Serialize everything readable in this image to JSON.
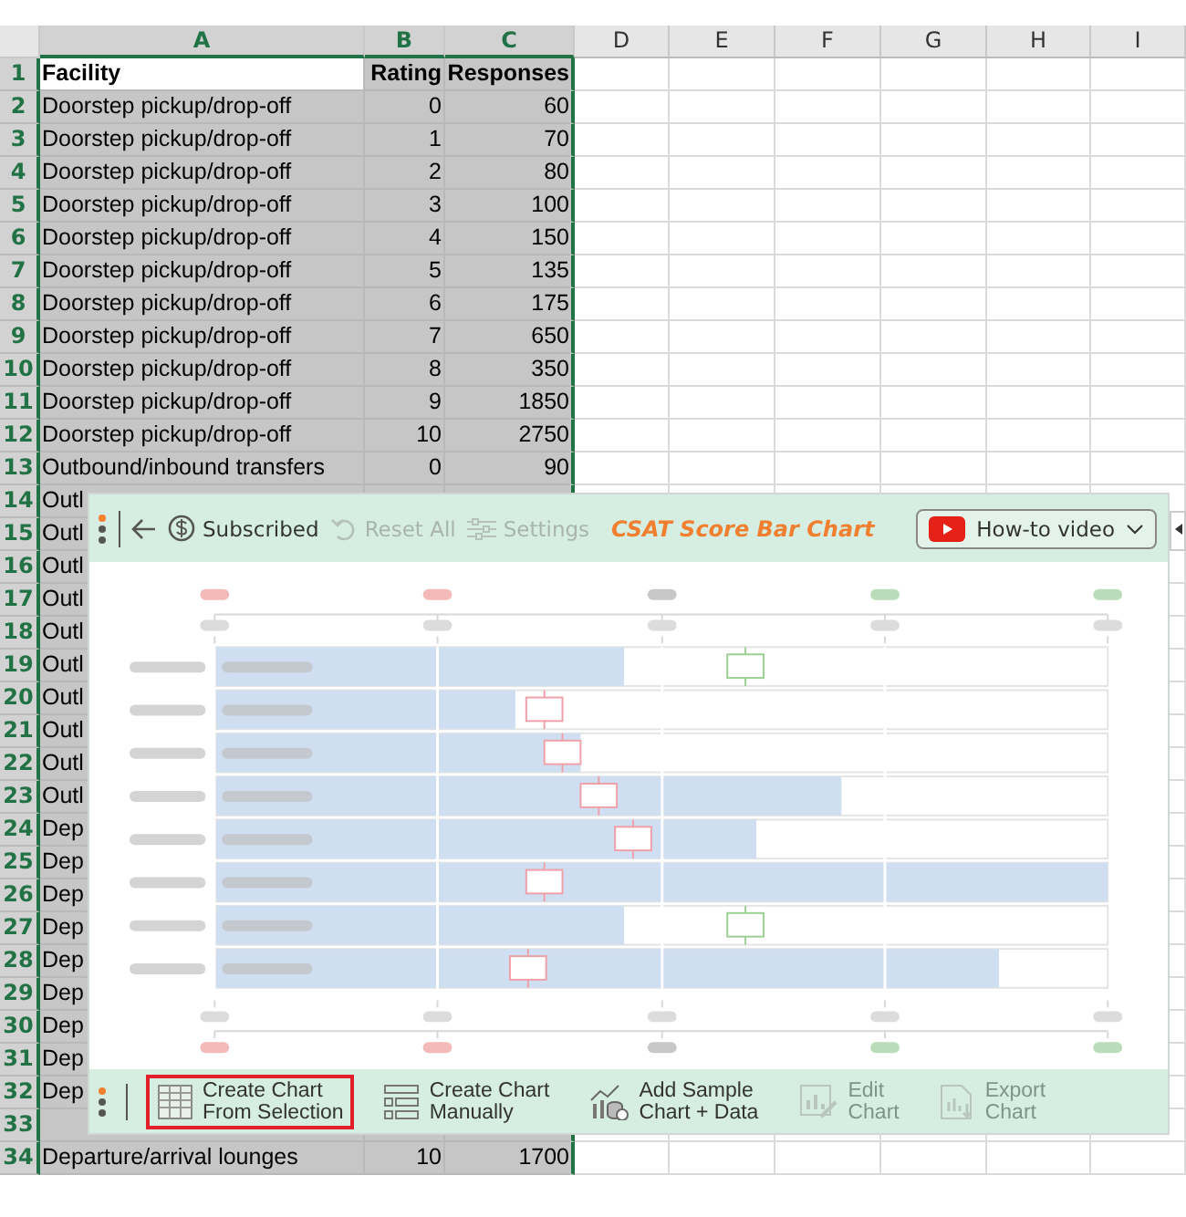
{
  "sheet": {
    "columns": [
      {
        "label": "A",
        "selected": true
      },
      {
        "label": "B",
        "selected": true
      },
      {
        "label": "C",
        "selected": true
      },
      {
        "label": "D",
        "selected": false
      },
      {
        "label": "E",
        "selected": false
      },
      {
        "label": "F",
        "selected": false
      },
      {
        "label": "G",
        "selected": false
      },
      {
        "label": "H",
        "selected": false
      },
      {
        "label": "I",
        "selected": false
      }
    ],
    "rows": [
      {
        "number": "1",
        "kind": "header",
        "cells": [
          "Facility",
          "Rating",
          "Responses"
        ]
      },
      {
        "number": "2",
        "cells": [
          "Doorstep pickup/drop-off",
          "0",
          "60"
        ]
      },
      {
        "number": "3",
        "cells": [
          "Doorstep pickup/drop-off",
          "1",
          "70"
        ]
      },
      {
        "number": "4",
        "cells": [
          "Doorstep pickup/drop-off",
          "2",
          "80"
        ]
      },
      {
        "number": "5",
        "cells": [
          "Doorstep pickup/drop-off",
          "3",
          "100"
        ]
      },
      {
        "number": "6",
        "cells": [
          "Doorstep pickup/drop-off",
          "4",
          "150"
        ]
      },
      {
        "number": "7",
        "cells": [
          "Doorstep pickup/drop-off",
          "5",
          "135"
        ]
      },
      {
        "number": "8",
        "cells": [
          "Doorstep pickup/drop-off",
          "6",
          "175"
        ]
      },
      {
        "number": "9",
        "cells": [
          "Doorstep pickup/drop-off",
          "7",
          "650"
        ]
      },
      {
        "number": "10",
        "cells": [
          "Doorstep pickup/drop-off",
          "8",
          "350"
        ]
      },
      {
        "number": "11",
        "cells": [
          "Doorstep pickup/drop-off",
          "9",
          "1850"
        ]
      },
      {
        "number": "12",
        "cells": [
          "Doorstep pickup/drop-off",
          "10",
          "2750"
        ]
      },
      {
        "number": "13",
        "cells": [
          "Outbound/inbound transfers",
          "0",
          "90"
        ]
      },
      {
        "number": "14",
        "cells": [
          "Outl"
        ]
      },
      {
        "number": "15",
        "cells": [
          "Outl"
        ]
      },
      {
        "number": "16",
        "cells": [
          "Outl"
        ]
      },
      {
        "number": "17",
        "cells": [
          "Outl"
        ]
      },
      {
        "number": "18",
        "cells": [
          "Outl"
        ]
      },
      {
        "number": "19",
        "cells": [
          "Outl"
        ]
      },
      {
        "number": "20",
        "cells": [
          "Outl"
        ]
      },
      {
        "number": "21",
        "cells": [
          "Outl"
        ]
      },
      {
        "number": "22",
        "cells": [
          "Outl"
        ]
      },
      {
        "number": "23",
        "cells": [
          "Outl"
        ]
      },
      {
        "number": "24",
        "cells": [
          "Dep"
        ]
      },
      {
        "number": "25",
        "cells": [
          "Dep"
        ]
      },
      {
        "number": "26",
        "cells": [
          "Dep"
        ]
      },
      {
        "number": "27",
        "cells": [
          "Dep"
        ]
      },
      {
        "number": "28",
        "cells": [
          "Dep"
        ]
      },
      {
        "number": "29",
        "cells": [
          "Dep"
        ]
      },
      {
        "number": "30",
        "cells": [
          "Dep"
        ]
      },
      {
        "number": "31",
        "cells": [
          "Dep"
        ]
      },
      {
        "number": "32",
        "cells": [
          "Dep"
        ]
      },
      {
        "number": "33",
        "cells": []
      },
      {
        "number": "34",
        "cells": [
          "Departure/arrival lounges",
          "10",
          "1700"
        ]
      }
    ]
  },
  "addin": {
    "toolbar": {
      "subscription": "Subscribed",
      "items": [
        {
          "label": "Reset All",
          "kind": "reset",
          "disabled": true
        },
        {
          "label": "Settings",
          "kind": "settings",
          "disabled": true
        }
      ],
      "title": "CSAT Score Bar Chart",
      "video_button": "How-to video"
    },
    "actions": [
      {
        "lines": [
          "Create Chart",
          "From Selection"
        ],
        "kind": "table",
        "selected": true,
        "disabled": false
      },
      {
        "lines": [
          "Create Chart",
          "Manually"
        ],
        "kind": "manual",
        "selected": false,
        "disabled": false
      },
      {
        "lines": [
          "Add Sample",
          "Chart + Data"
        ],
        "kind": "sample",
        "selected": false,
        "disabled": false
      },
      {
        "lines": [
          "Edit",
          "Chart"
        ],
        "kind": "edit",
        "selected": false,
        "disabled": true
      },
      {
        "lines": [
          "Export",
          "Chart"
        ],
        "kind": "export",
        "selected": false,
        "disabled": true
      }
    ]
  }
}
